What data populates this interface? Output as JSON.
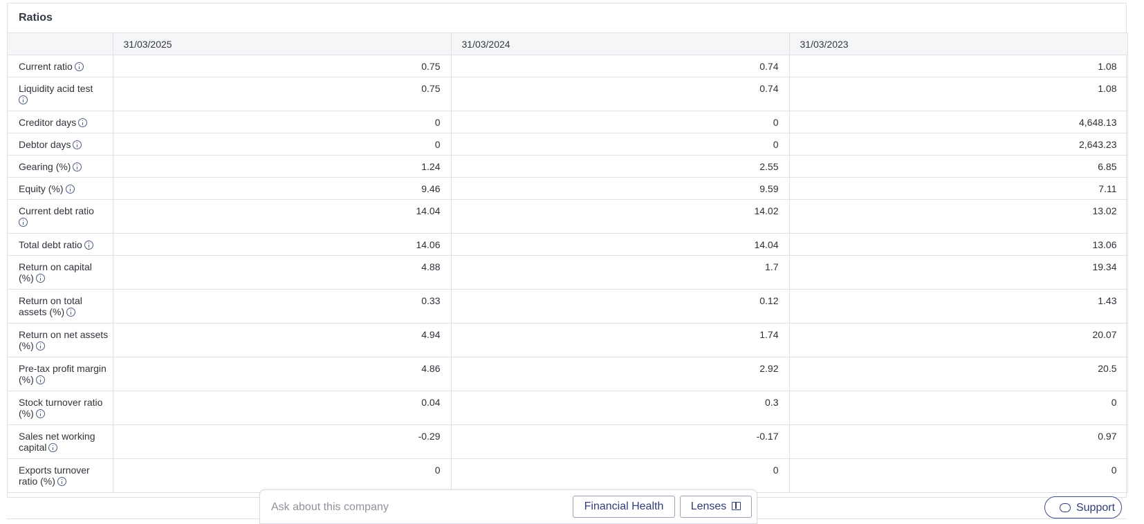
{
  "panel": {
    "title": "Ratios"
  },
  "columns": [
    "",
    "31/03/2025",
    "31/03/2024",
    "31/03/2023"
  ],
  "rows": [
    {
      "label": "Current ratio",
      "values": [
        "0.75",
        "0.74",
        "1.08"
      ]
    },
    {
      "label": "Liquidity acid test",
      "values": [
        "0.75",
        "0.74",
        "1.08"
      ]
    },
    {
      "label": "Creditor days",
      "values": [
        "0",
        "0",
        "4,648.13"
      ]
    },
    {
      "label": "Debtor days",
      "values": [
        "0",
        "0",
        "2,643.23"
      ]
    },
    {
      "label": "Gearing (%)",
      "values": [
        "1.24",
        "2.55",
        "6.85"
      ]
    },
    {
      "label": "Equity (%)",
      "values": [
        "9.46",
        "9.59",
        "7.11"
      ]
    },
    {
      "label": "Current debt ratio",
      "values": [
        "14.04",
        "14.02",
        "13.02"
      ]
    },
    {
      "label": "Total debt ratio",
      "values": [
        "14.06",
        "14.04",
        "13.06"
      ]
    },
    {
      "label": "Return on capital (%)",
      "values": [
        "4.88",
        "1.7",
        "19.34"
      ]
    },
    {
      "label": "Return on total assets (%)",
      "values": [
        "0.33",
        "0.12",
        "1.43"
      ]
    },
    {
      "label": "Return on net assets (%)",
      "values": [
        "4.94",
        "1.74",
        "20.07"
      ]
    },
    {
      "label": "Pre-tax profit margin (%)",
      "values": [
        "4.86",
        "2.92",
        "20.5"
      ]
    },
    {
      "label": "Stock turnover ratio (%)",
      "values": [
        "0.04",
        "0.3",
        "0"
      ]
    },
    {
      "label": "Sales net working capital",
      "values": [
        "-0.29",
        "-0.17",
        "0.97"
      ]
    },
    {
      "label": "Exports turnover ratio (%)",
      "values": [
        "0",
        "0",
        "0"
      ]
    }
  ],
  "ask": {
    "placeholder": "Ask about this company",
    "financial_health_label": "Financial Health",
    "lenses_label": "Lenses"
  },
  "support": {
    "label": "Support"
  },
  "icons": {
    "info": "info-icon",
    "lenses": "book-icon",
    "support": "chat-icon"
  },
  "colors": {
    "accent": "#2f3d78",
    "border": "#dfe1e5",
    "header_bg": "#f5f6f7"
  }
}
